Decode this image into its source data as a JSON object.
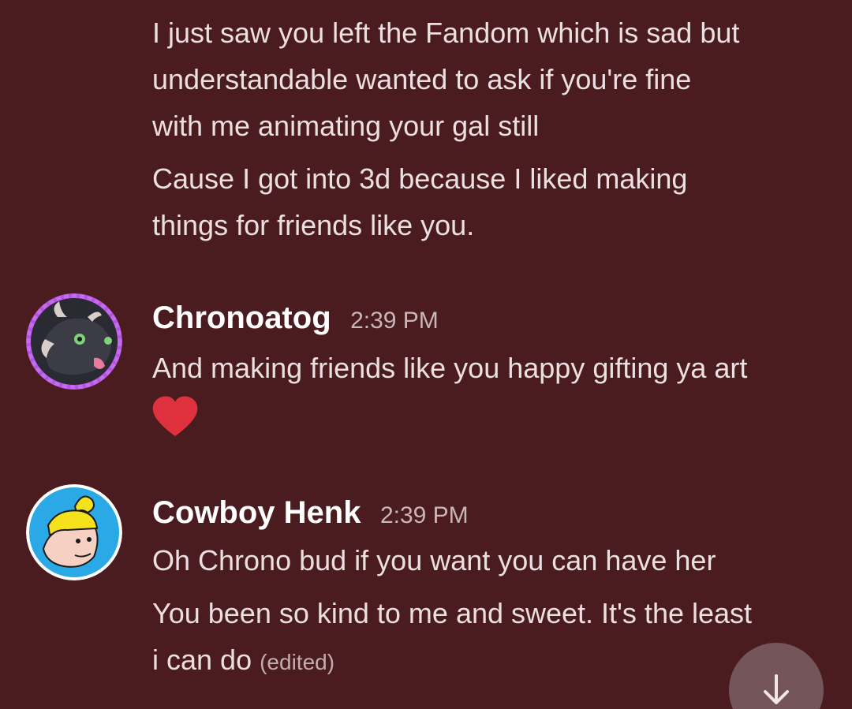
{
  "messages": {
    "continuation": {
      "lines": [
        "I just saw you left the Fandom which is sad  but",
        "understandable wanted to ask if you're fine",
        "with me animating your gal still",
        "Cause I got into 3d because I liked making",
        "things for friends like you."
      ]
    },
    "chrono": {
      "username": "Chronoatog",
      "timestamp": "2:39 PM",
      "text": "And making friends like you happy gifting ya art",
      "reaction_icon": "heart-emoji"
    },
    "henk": {
      "username": "Cowboy Henk",
      "timestamp": "2:39 PM",
      "line1": "Oh Chrono bud if you want you can have her",
      "line2": "You been so kind to me and sweet. It's the least",
      "line3": "i can do",
      "edited": "(edited)"
    }
  },
  "colors": {
    "background": "#4a1c1f",
    "text": "#ecdfe0",
    "timestamp": "#c9b6b8",
    "heart": "#e0313f",
    "scroll_button": "#73555a"
  },
  "scroll_button": {
    "icon": "arrow-down-icon"
  }
}
